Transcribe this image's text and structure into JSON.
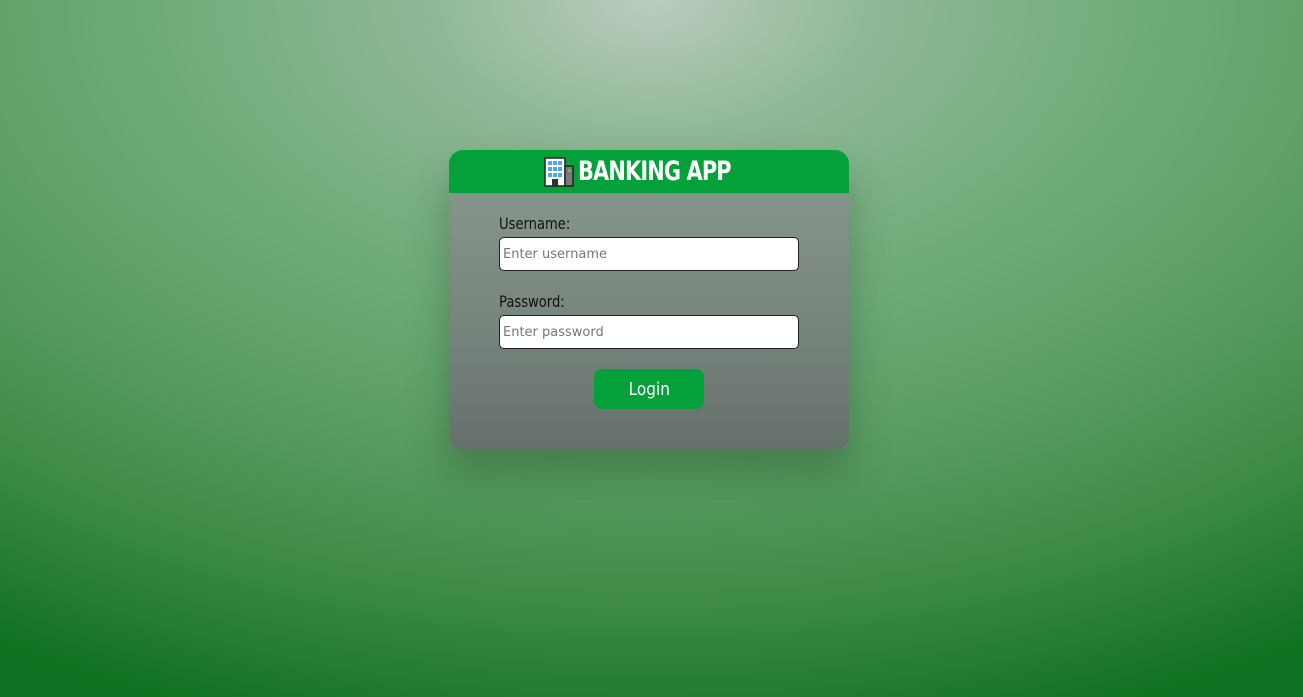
{
  "header": {
    "icon": "bank-building-icon",
    "title": "BANKING APP"
  },
  "form": {
    "username": {
      "label": "Username:",
      "value": "",
      "placeholder": "Enter username"
    },
    "password": {
      "label": "Password:",
      "value": "",
      "placeholder": "Enter password"
    },
    "submit_label": "Login"
  },
  "colors": {
    "accent": "#04a03a",
    "header_text": "#ffffff",
    "card_background": "#7f8e85"
  }
}
